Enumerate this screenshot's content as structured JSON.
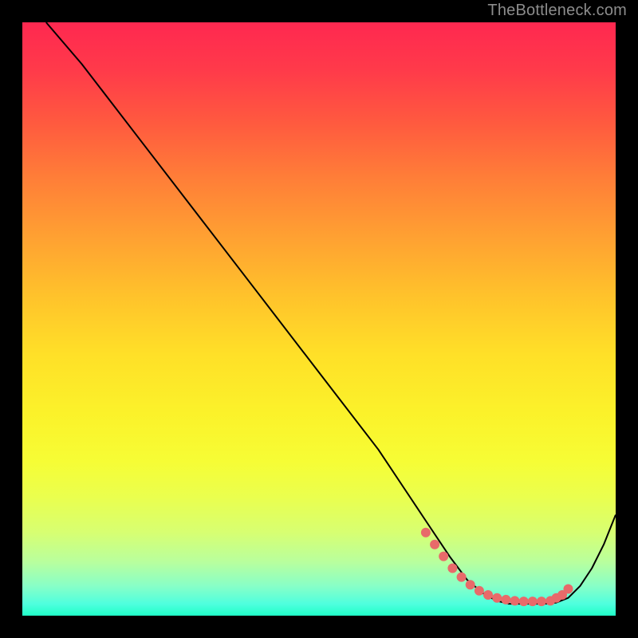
{
  "attribution": "TheBottleneck.com",
  "chart_data": {
    "type": "line",
    "title": "",
    "xlabel": "",
    "ylabel": "",
    "xlim": [
      0,
      100
    ],
    "ylim": [
      0,
      100
    ],
    "background_gradient": {
      "top": "#ff2850",
      "mid": "#ffe028",
      "bottom": "#20ffc8"
    },
    "series": [
      {
        "name": "curve",
        "x": [
          4,
          10,
          20,
          30,
          40,
          50,
          60,
          68,
          72,
          75,
          78,
          80,
          82,
          84,
          86,
          88,
          90,
          92,
          94,
          96,
          98,
          100
        ],
        "y": [
          100,
          93,
          80,
          67,
          54,
          41,
          28,
          16,
          10,
          6,
          3.5,
          2.5,
          2,
          2,
          2,
          2,
          2.2,
          3,
          5,
          8,
          12,
          17
        ]
      }
    ],
    "markers": {
      "name": "highlighted-points",
      "color": "#e86a6a",
      "x": [
        68,
        69.5,
        71,
        72.5,
        74,
        75.5,
        77,
        78.5,
        80,
        81.5,
        83,
        84.5,
        86,
        87.5,
        89,
        90,
        91,
        92
      ],
      "y": [
        14,
        12,
        10,
        8,
        6.5,
        5.2,
        4.2,
        3.5,
        3,
        2.7,
        2.5,
        2.4,
        2.4,
        2.4,
        2.5,
        3.0,
        3.5,
        4.5
      ]
    }
  }
}
